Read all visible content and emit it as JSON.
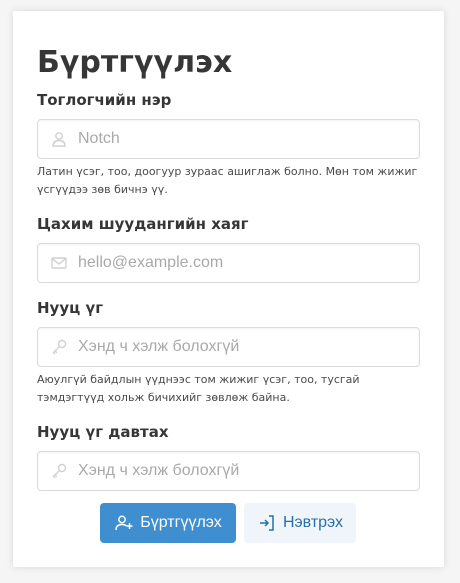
{
  "page": {
    "title": "Бүртгүүлэх"
  },
  "form": {
    "username": {
      "label": "Тоглогчийн нэр",
      "placeholder": "Notch",
      "value": "",
      "help": "Латин үсэг, тоо, доогуур зураас ашиглаж болно. Мөн том жижиг үсгүүдээ зөв бичнэ үү.",
      "icon": "user-icon"
    },
    "email": {
      "label": "Цахим шуудангийн хаяг",
      "placeholder": "hello@example.com",
      "value": "",
      "icon": "envelope-icon"
    },
    "password": {
      "label": "Нууц үг",
      "placeholder": "Хэнд ч хэлж болохгүй",
      "value": "",
      "help": "Аюулгүй байдлын үүднээс том жижиг үсэг, тоо, тусгай тэмдэгтүүд хольж бичихийг зөвлөж байна.",
      "icon": "key-icon"
    },
    "password_confirm": {
      "label": "Нууц үг давтах",
      "placeholder": "Хэнд ч хэлж болохгүй",
      "value": "",
      "icon": "key-icon"
    }
  },
  "actions": {
    "register_label": "Бүртгүүлэх",
    "login_label": "Нэвтрэх"
  },
  "colors": {
    "primary": "#3e8ed0",
    "light_bg": "#eff5fb",
    "light_text": "#296fa8",
    "page_bg": "#f5f5f5"
  }
}
